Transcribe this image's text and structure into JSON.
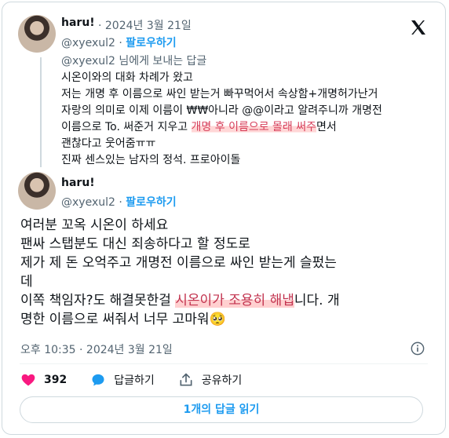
{
  "quoted": {
    "name": "haru!",
    "date": "· 2024년 3월 21일",
    "handle": "@xyexul2",
    "follow_label": "팔로우하기",
    "reply_to": "@xyexul2 님에게 보내는 답글",
    "lines": [
      "시온이와의 대화 차례가 왔고",
      "저는 개명 후 이름으로 싸인 받는거 빠꾸먹어서 속상함+개명허가난거",
      "자랑의 의미로 이제 이름이 ₩₩아니라 @@이라고 알려주니까 개명전",
      "이름으로 To. 써준거 지우고 ",
      "개명 후 이름으로 몰래 써주",
      "면서",
      "괜찮다고 웃어줌ㅠㅠ",
      "진짜 센스있는 남자의 정석. 프로아이돌"
    ]
  },
  "main": {
    "name": "haru!",
    "handle": "@xyexul2",
    "follow_label": "팔로우하기",
    "lines": [
      "여러분 꼬옥 시온이 하세요",
      "팬싸 스탭분도 대신 죄송하다고 할 정도로",
      "제가 제 돈 오억주고 개명전 이름으로 싸인 받는게 슬펐는",
      "데",
      "이쪽 책임자?도 해결못한걸 ",
      "시온이가 조용히 해냅",
      "니다. 개",
      "명한 이름으로 써줘서 너무 고마워🥺"
    ],
    "timestamp": "오후 10:35 · 2024년 3월 21일"
  },
  "actions": {
    "like_count": "392",
    "reply_label": "답글하기",
    "share_label": "공유하기"
  },
  "more_button": "1개의 답글 읽기",
  "colors": {
    "accent": "#1d9bf0",
    "like": "#f91880",
    "highlight": "#ffd0d0"
  }
}
